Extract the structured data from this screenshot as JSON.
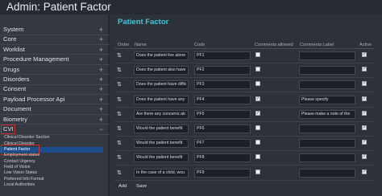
{
  "app": {
    "title": "Admin: Patient Factor"
  },
  "sidebar": {
    "items": [
      {
        "label": "System",
        "exp": "+"
      },
      {
        "label": "Core",
        "exp": "+"
      },
      {
        "label": "Worklist",
        "exp": "+"
      },
      {
        "label": "Procedure Management",
        "exp": "+"
      },
      {
        "label": "Drugs",
        "exp": "+"
      },
      {
        "label": "Disorders",
        "exp": "+"
      },
      {
        "label": "Consent",
        "exp": "+"
      },
      {
        "label": "Payload Processor Api",
        "exp": "+"
      },
      {
        "label": "Document",
        "exp": "+"
      },
      {
        "label": "Biometry",
        "exp": "+"
      },
      {
        "label": "CVI",
        "exp": "−"
      }
    ],
    "subitems": [
      {
        "label": "Clinical Disorder Section"
      },
      {
        "label": "Clinical Disorder"
      },
      {
        "label": "Patient Factor",
        "active": true
      },
      {
        "label": "Employment status"
      },
      {
        "label": "Contact Urgency"
      },
      {
        "label": "Field of Vision"
      },
      {
        "label": "Low Vision Status"
      },
      {
        "label": "Preferred Info Format"
      },
      {
        "label": "Local Authorities"
      }
    ]
  },
  "main": {
    "heading": "Patient Factor",
    "columns": {
      "order": "Order",
      "name": "Name",
      "code": "Code",
      "comments_allowed": "Comments allowed",
      "comments_label": "Comments Label",
      "active": "Active"
    },
    "order_icon": "⇅",
    "rows": [
      {
        "name": "Does the patient live alone",
        "code": "PF1",
        "comments_allowed": false,
        "comments_label": "",
        "active": true
      },
      {
        "name": "Does the patient also have",
        "code": "PF2",
        "comments_allowed": false,
        "comments_label": "",
        "active": true
      },
      {
        "name": "Does the patient have diffic",
        "code": "PF3",
        "comments_allowed": false,
        "comments_label": "",
        "active": true
      },
      {
        "name": "Does the patient have any",
        "code": "PF4",
        "comments_allowed": true,
        "comments_label": "Please specify",
        "active": true
      },
      {
        "name": "Are there any concerns ab",
        "code": "PF5",
        "comments_allowed": true,
        "comments_label": "Please make a note of the",
        "active": true
      },
      {
        "name": "Would the patient benefit",
        "code": "PF6",
        "comments_allowed": false,
        "comments_label": "",
        "active": true
      },
      {
        "name": "Would the patient benefit",
        "code": "PF7",
        "comments_allowed": false,
        "comments_label": "",
        "active": true
      },
      {
        "name": "Would the patient benefit",
        "code": "PF8",
        "comments_allowed": false,
        "comments_label": "",
        "active": true
      },
      {
        "name": "In the case of a child, wou",
        "code": "PF9",
        "comments_allowed": false,
        "comments_label": "",
        "active": true
      }
    ],
    "buttons": {
      "add": "Add",
      "save": "Save"
    }
  }
}
